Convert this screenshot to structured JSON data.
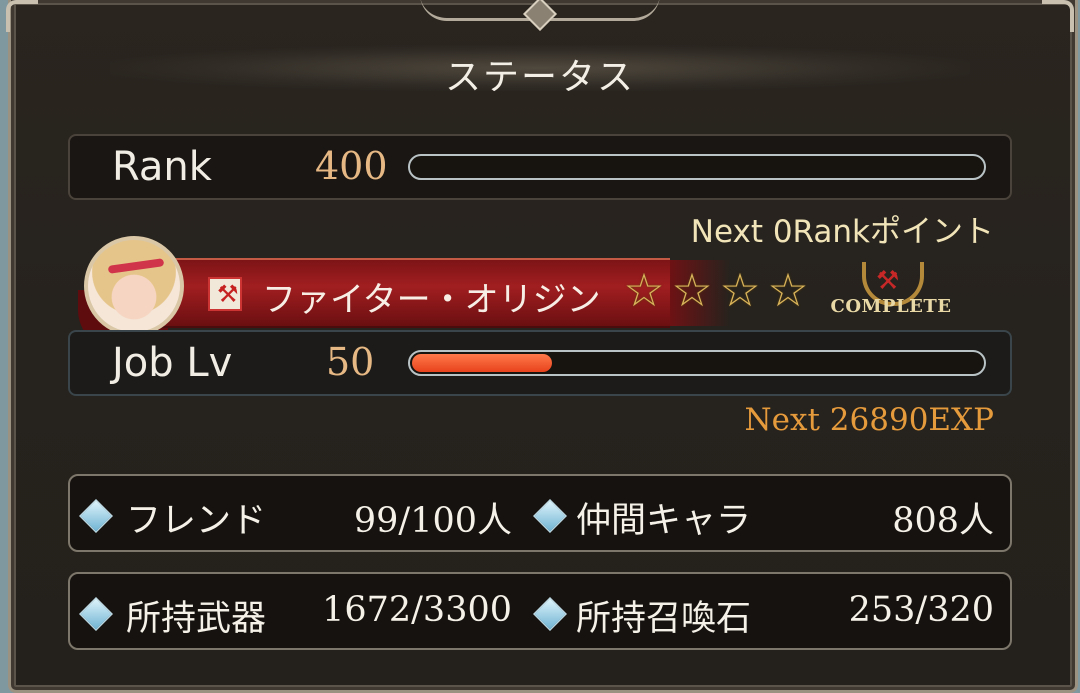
{
  "window": {
    "title": "ステータス"
  },
  "rank": {
    "label": "Rank",
    "value": "400",
    "progress": 0,
    "next_text": "Next 0Rankポイント"
  },
  "job": {
    "name": "ファイター・オリジン",
    "icon": "axe-icon",
    "stars": 4,
    "complete_badge": "COMPLETE",
    "level_label": "Job Lv",
    "level_value": "50",
    "progress": 0.25,
    "next_text": "Next 26890EXP"
  },
  "stats": [
    {
      "label": "フレンド",
      "value": "99/100人"
    },
    {
      "label": "仲間キャラ",
      "value": "808人"
    },
    {
      "label": "所持武器",
      "value": "1672/3300"
    },
    {
      "label": "所持召喚石",
      "value": "253/320"
    }
  ],
  "colors": {
    "panel_bg": "#26221d",
    "job_bar_fill": "#e8421c",
    "ribbon": "#a11e20",
    "rank_value": "#e5b884",
    "exp_text": "#e59a3c"
  }
}
